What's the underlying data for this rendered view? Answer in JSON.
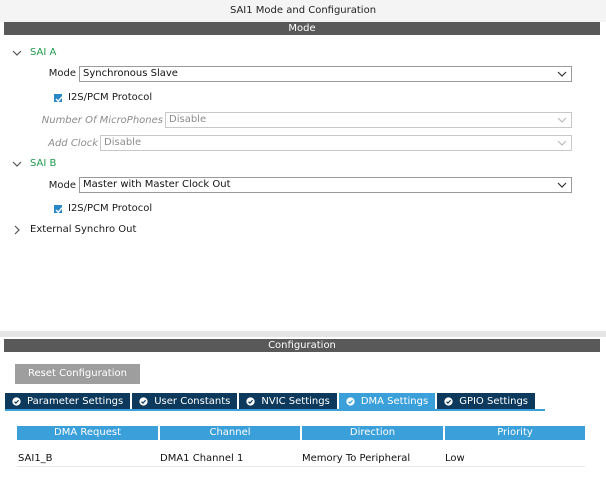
{
  "window": {
    "title": "SAI1 Mode and Configuration"
  },
  "mode": {
    "header": "Mode",
    "sai_a": {
      "label": "SAI A",
      "mode_label": "Mode",
      "mode_value": "Synchronous Slave",
      "protocol_label": "I2S/PCM Protocol",
      "protocol_checked": true,
      "mic_label": "Number Of MicroPhones",
      "mic_value": "Disable",
      "clock_label": "Add Clock",
      "clock_value": "Disable"
    },
    "sai_b": {
      "label": "SAI B",
      "mode_label": "Mode",
      "mode_value": "Master with Master Clock Out",
      "protocol_label": "I2S/PCM Protocol",
      "protocol_checked": true
    },
    "external_synchro": {
      "label": "External Synchro Out"
    }
  },
  "configuration": {
    "header": "Configuration",
    "reset_label": "Reset Configuration",
    "tabs": [
      {
        "label": "Parameter Settings",
        "active": false
      },
      {
        "label": "User Constants",
        "active": false
      },
      {
        "label": "NVIC Settings",
        "active": false
      },
      {
        "label": "DMA Settings",
        "active": true
      },
      {
        "label": "GPIO Settings",
        "active": false
      }
    ],
    "table": {
      "columns": [
        "DMA Request",
        "Channel",
        "Direction",
        "Priority"
      ],
      "rows": [
        [
          "SAI1_B",
          "DMA1 Channel 1",
          "Memory To Peripheral",
          "Low"
        ]
      ]
    }
  },
  "colors": {
    "header_bg": "#595959",
    "tab_bg": "#0d3a5c",
    "tab_active_bg": "#3ba0da",
    "accent_green": "#1f9a4c",
    "checkbox_blue": "#2b88c6"
  }
}
